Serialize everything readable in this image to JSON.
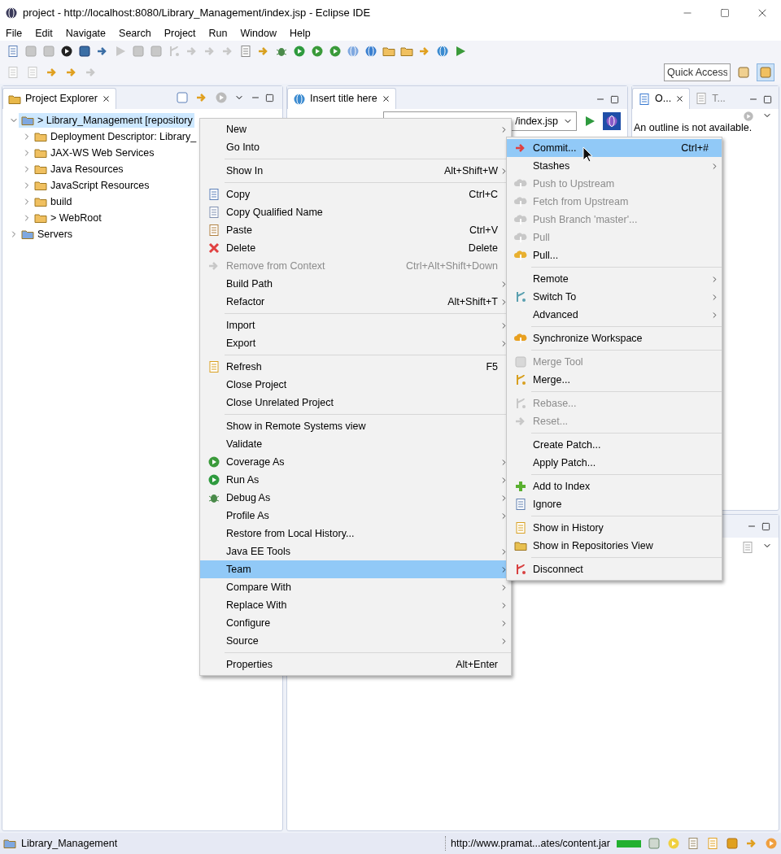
{
  "window": {
    "title": "project - http://localhost:8080/Library_Management/index.jsp - Eclipse IDE"
  },
  "menu_bar": [
    "File",
    "Edit",
    "Navigate",
    "Search",
    "Project",
    "Run",
    "Window",
    "Help"
  ],
  "quick_access": {
    "placeholder": "Quick Access"
  },
  "project_explorer": {
    "tab": {
      "label": "Project Explorer",
      "selected": true
    },
    "tree": [
      {
        "label": "> Library_Management [repository",
        "expanded": true,
        "selected": true,
        "children": [
          {
            "label": "Deployment Descriptor: Library_",
            "expanded": false,
            "selected": false
          },
          {
            "label": "JAX-WS Web Services",
            "expanded": false,
            "selected": false
          },
          {
            "label": "Java Resources",
            "expanded": false,
            "selected": false
          },
          {
            "label": "JavaScript Resources",
            "expanded": false,
            "selected": false
          },
          {
            "label": "build",
            "expanded": false,
            "selected": false
          },
          {
            "label": "> WebRoot",
            "expanded": false,
            "selected": false
          }
        ]
      },
      {
        "label": "Servers",
        "expanded": false,
        "selected": false
      }
    ]
  },
  "editor": {
    "tab": {
      "label": "Insert title here",
      "selected": true
    },
    "url": "/index.jsp"
  },
  "outline": {
    "tabs": [
      {
        "label": "O...",
        "selected": true
      },
      {
        "label": "T...",
        "selected": false
      }
    ],
    "message": "An outline is not available."
  },
  "context_menu": {
    "items": [
      {
        "kind": "item",
        "label": "New",
        "submenu": true,
        "disabled": false,
        "selected": false
      },
      {
        "kind": "item",
        "label": "Go Into",
        "submenu": false,
        "disabled": false,
        "selected": false
      },
      {
        "kind": "separator"
      },
      {
        "kind": "item",
        "label": "Show In",
        "shortcut": "Alt+Shift+W",
        "submenu": true,
        "disabled": false,
        "selected": false
      },
      {
        "kind": "separator"
      },
      {
        "kind": "item",
        "label": "Copy",
        "shortcut": "Ctrl+C",
        "submenu": false,
        "disabled": false,
        "selected": false
      },
      {
        "kind": "item",
        "label": "Copy Qualified Name",
        "submenu": false,
        "disabled": false,
        "selected": false
      },
      {
        "kind": "item",
        "label": "Paste",
        "shortcut": "Ctrl+V",
        "submenu": false,
        "disabled": false,
        "selected": false
      },
      {
        "kind": "item",
        "label": "Delete",
        "shortcut": "Delete",
        "submenu": false,
        "disabled": false,
        "selected": false
      },
      {
        "kind": "item",
        "label": "Remove from Context",
        "shortcut": "Ctrl+Alt+Shift+Down",
        "submenu": false,
        "disabled": true,
        "selected": false
      },
      {
        "kind": "item",
        "label": "Build Path",
        "submenu": true,
        "disabled": false,
        "selected": false
      },
      {
        "kind": "item",
        "label": "Refactor",
        "shortcut": "Alt+Shift+T",
        "submenu": true,
        "disabled": false,
        "selected": false
      },
      {
        "kind": "separator"
      },
      {
        "kind": "item",
        "label": "Import",
        "submenu": true,
        "disabled": false,
        "selected": false
      },
      {
        "kind": "item",
        "label": "Export",
        "submenu": true,
        "disabled": false,
        "selected": false
      },
      {
        "kind": "separator"
      },
      {
        "kind": "item",
        "label": "Refresh",
        "shortcut": "F5",
        "submenu": false,
        "disabled": false,
        "selected": false
      },
      {
        "kind": "item",
        "label": "Close Project",
        "submenu": false,
        "disabled": false,
        "selected": false
      },
      {
        "kind": "item",
        "label": "Close Unrelated Project",
        "submenu": false,
        "disabled": false,
        "selected": false
      },
      {
        "kind": "separator"
      },
      {
        "kind": "item",
        "label": "Show in Remote Systems view",
        "submenu": false,
        "disabled": false,
        "selected": false
      },
      {
        "kind": "item",
        "label": "Validate",
        "submenu": false,
        "disabled": false,
        "selected": false
      },
      {
        "kind": "item",
        "label": "Coverage As",
        "submenu": true,
        "disabled": false,
        "selected": false
      },
      {
        "kind": "item",
        "label": "Run As",
        "submenu": true,
        "disabled": false,
        "selected": false
      },
      {
        "kind": "item",
        "label": "Debug As",
        "submenu": true,
        "disabled": false,
        "selected": false
      },
      {
        "kind": "item",
        "label": "Profile As",
        "submenu": true,
        "disabled": false,
        "selected": false
      },
      {
        "kind": "item",
        "label": "Restore from Local History...",
        "submenu": false,
        "disabled": false,
        "selected": false
      },
      {
        "kind": "item",
        "label": "Java EE Tools",
        "submenu": true,
        "disabled": false,
        "selected": false
      },
      {
        "kind": "item",
        "label": "Team",
        "submenu": true,
        "disabled": false,
        "selected": true
      },
      {
        "kind": "item",
        "label": "Compare With",
        "submenu": true,
        "disabled": false,
        "selected": false
      },
      {
        "kind": "item",
        "label": "Replace With",
        "submenu": true,
        "disabled": false,
        "selected": false
      },
      {
        "kind": "item",
        "label": "Configure",
        "submenu": true,
        "disabled": false,
        "selected": false
      },
      {
        "kind": "item",
        "label": "Source",
        "submenu": true,
        "disabled": false,
        "selected": false
      },
      {
        "kind": "separator"
      },
      {
        "kind": "item",
        "label": "Properties",
        "shortcut": "Alt+Enter",
        "submenu": false,
        "disabled": false,
        "selected": false
      }
    ]
  },
  "team_submenu": {
    "items": [
      {
        "kind": "item",
        "label": "Commit...",
        "shortcut": "Ctrl+#",
        "submenu": false,
        "disabled": false,
        "selected": true
      },
      {
        "kind": "item",
        "label": "Stashes",
        "submenu": true,
        "disabled": false,
        "selected": false
      },
      {
        "kind": "item",
        "label": "Push to Upstream",
        "submenu": false,
        "disabled": true,
        "selected": false
      },
      {
        "kind": "item",
        "label": "Fetch from Upstream",
        "submenu": false,
        "disabled": true,
        "selected": false
      },
      {
        "kind": "item",
        "label": "Push Branch 'master'...",
        "submenu": false,
        "disabled": true,
        "selected": false
      },
      {
        "kind": "item",
        "label": "Pull",
        "submenu": false,
        "disabled": true,
        "selected": false
      },
      {
        "kind": "item",
        "label": "Pull...",
        "submenu": false,
        "disabled": false,
        "selected": false
      },
      {
        "kind": "separator"
      },
      {
        "kind": "item",
        "label": "Remote",
        "submenu": true,
        "disabled": false,
        "selected": false
      },
      {
        "kind": "item",
        "label": "Switch To",
        "submenu": true,
        "disabled": false,
        "selected": false
      },
      {
        "kind": "item",
        "label": "Advanced",
        "submenu": true,
        "disabled": false,
        "selected": false
      },
      {
        "kind": "separator"
      },
      {
        "kind": "item",
        "label": "Synchronize Workspace",
        "submenu": false,
        "disabled": false,
        "selected": false
      },
      {
        "kind": "separator"
      },
      {
        "kind": "item",
        "label": "Merge Tool",
        "submenu": false,
        "disabled": true,
        "selected": false
      },
      {
        "kind": "item",
        "label": "Merge...",
        "submenu": false,
        "disabled": false,
        "selected": false
      },
      {
        "kind": "separator"
      },
      {
        "kind": "item",
        "label": "Rebase...",
        "submenu": false,
        "disabled": true,
        "selected": false
      },
      {
        "kind": "item",
        "label": "Reset...",
        "submenu": false,
        "disabled": true,
        "selected": false
      },
      {
        "kind": "separator"
      },
      {
        "kind": "item",
        "label": "Create Patch...",
        "submenu": false,
        "disabled": false,
        "selected": false
      },
      {
        "kind": "item",
        "label": "Apply Patch...",
        "submenu": false,
        "disabled": false,
        "selected": false
      },
      {
        "kind": "separator"
      },
      {
        "kind": "item",
        "label": "Add to Index",
        "submenu": false,
        "disabled": false,
        "selected": false
      },
      {
        "kind": "item",
        "label": "Ignore",
        "submenu": false,
        "disabled": false,
        "selected": false
      },
      {
        "kind": "separator"
      },
      {
        "kind": "item",
        "label": "Show in History",
        "submenu": false,
        "disabled": false,
        "selected": false
      },
      {
        "kind": "item",
        "label": "Show in Repositories View",
        "submenu": false,
        "disabled": false,
        "selected": false
      },
      {
        "kind": "separator"
      },
      {
        "kind": "item",
        "label": "Disconnect",
        "submenu": false,
        "disabled": false,
        "selected": false
      }
    ]
  },
  "status_bar": {
    "project": "Library_Management",
    "url": "http://www.pramat...ates/content.jar",
    "progress": {
      "level": 1
    }
  }
}
